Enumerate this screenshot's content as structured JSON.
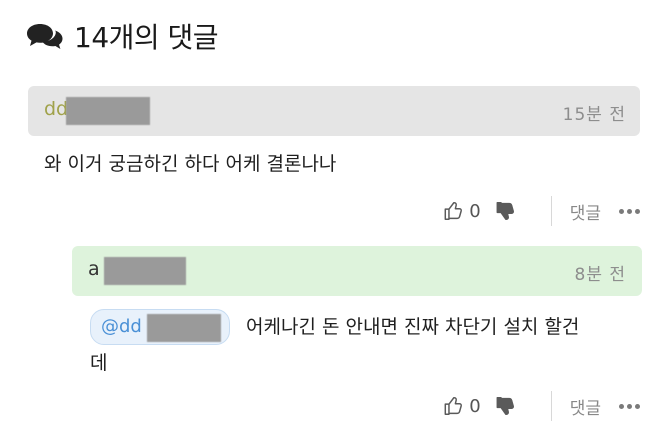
{
  "header": {
    "icon": "speech-bubbles-icon",
    "title": "14개의 댓글"
  },
  "comments": [
    {
      "author_prefix": "dd",
      "time": "15분 전",
      "text": "와 이거 궁금하긴 하다 어케 결론나나",
      "likes": "0",
      "reply_label": "댓글",
      "bar_color": "#e5e5e5"
    },
    {
      "author_prefix": "a",
      "time": "8분 전",
      "mention": "@dd",
      "text_line1": "어케나긴 돈 안내면 진짜 차단기 설치 할건",
      "text_line2": "데",
      "likes": "0",
      "reply_label": "댓글",
      "bar_color": "#def3dc"
    }
  ],
  "colors": {
    "mention": "#4a90d6",
    "timestamp": "#8d8d8d"
  }
}
